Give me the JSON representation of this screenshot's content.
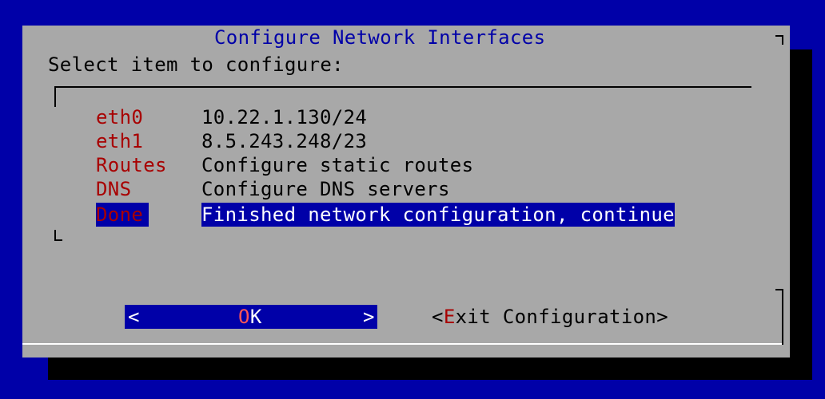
{
  "dialog": {
    "title": "Configure Network Interfaces",
    "prompt": "Select item to configure:"
  },
  "menu": {
    "items": [
      {
        "tag": "eth0",
        "description": "10.22.1.130/24",
        "selected": false
      },
      {
        "tag": "eth1",
        "description": "8.5.243.248/23",
        "selected": false
      },
      {
        "tag": "Routes",
        "description": "Configure static routes",
        "selected": false
      },
      {
        "tag": "DNS",
        "description": "Configure DNS servers",
        "selected": false
      },
      {
        "tag": "Done",
        "description": "Finished network configuration, continue",
        "selected": true
      }
    ]
  },
  "buttons": {
    "ok": {
      "left_bracket": "<",
      "hot_key": "O",
      "rest": "K",
      "right_bracket": ">"
    },
    "exit": {
      "open": "<",
      "hot_key": "E",
      "rest": "xit Configuration",
      "close": ">"
    }
  },
  "colors": {
    "background": "#0000a8",
    "dialog": "#a8a8a8",
    "shadow": "#000000",
    "tag": "#a80000",
    "selection": "#0000a8",
    "title": "#0000a8"
  }
}
